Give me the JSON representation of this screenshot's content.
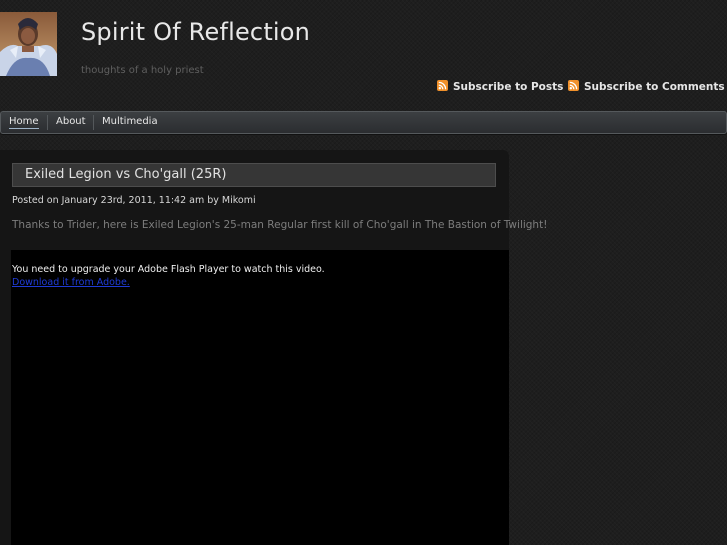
{
  "header": {
    "site_title": "Spirit Of Reflection",
    "tagline": "thoughts of a holy priest",
    "subscribe_posts": "Subscribe to Posts",
    "subscribe_comments": "Subscribe to Comments"
  },
  "nav": {
    "items": [
      {
        "label": "Home",
        "active": true
      },
      {
        "label": "About",
        "active": false
      },
      {
        "label": "Multimedia",
        "active": false
      }
    ]
  },
  "post": {
    "title": "Exiled Legion vs Cho'gall (25R)",
    "meta": "Posted on January 23rd, 2011, 11:42 am by Mikomi",
    "body": "Thanks to Trider, here is Exiled Legion's 25-man Regular first kill of Cho'gall in The Bastion of Twilight!",
    "video": {
      "message": "You need to upgrade your Adobe Flash Player to watch this video.",
      "link_text": "Download it from Adobe."
    }
  },
  "icons": {
    "rss": "rss-feed-icon",
    "avatar": "priest-avatar"
  },
  "colors": {
    "background": "#1e1e1e",
    "rss_orange": "#f0902a",
    "link_blue": "#1f3bd6",
    "nav_underline": "#9fb4c8"
  }
}
